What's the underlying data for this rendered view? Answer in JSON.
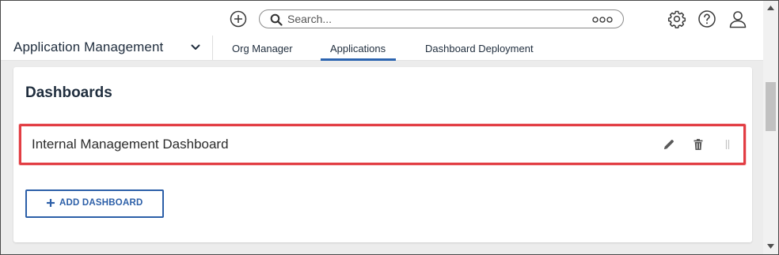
{
  "header": {
    "search_placeholder": "Search...",
    "icons": [
      "plus-circle-icon",
      "search-icon",
      "more-icon",
      "gear-icon",
      "help-icon",
      "user-icon"
    ]
  },
  "app_nav": {
    "app_name": "Application Management",
    "tabs": [
      {
        "label": "Org Manager",
        "active": false
      },
      {
        "label": "Applications",
        "active": true
      },
      {
        "label": "Dashboard Deployment",
        "active": false
      }
    ]
  },
  "dashboards": {
    "title": "Dashboards",
    "items": [
      {
        "label": "Internal Management Dashboard"
      }
    ],
    "add_button_label": "ADD DASHBOARD"
  },
  "colors": {
    "accent": "#2c5fa8",
    "active_tab_underline": "#2c64b0",
    "highlight_border": "#e23d43",
    "page_background": "#ececec"
  }
}
